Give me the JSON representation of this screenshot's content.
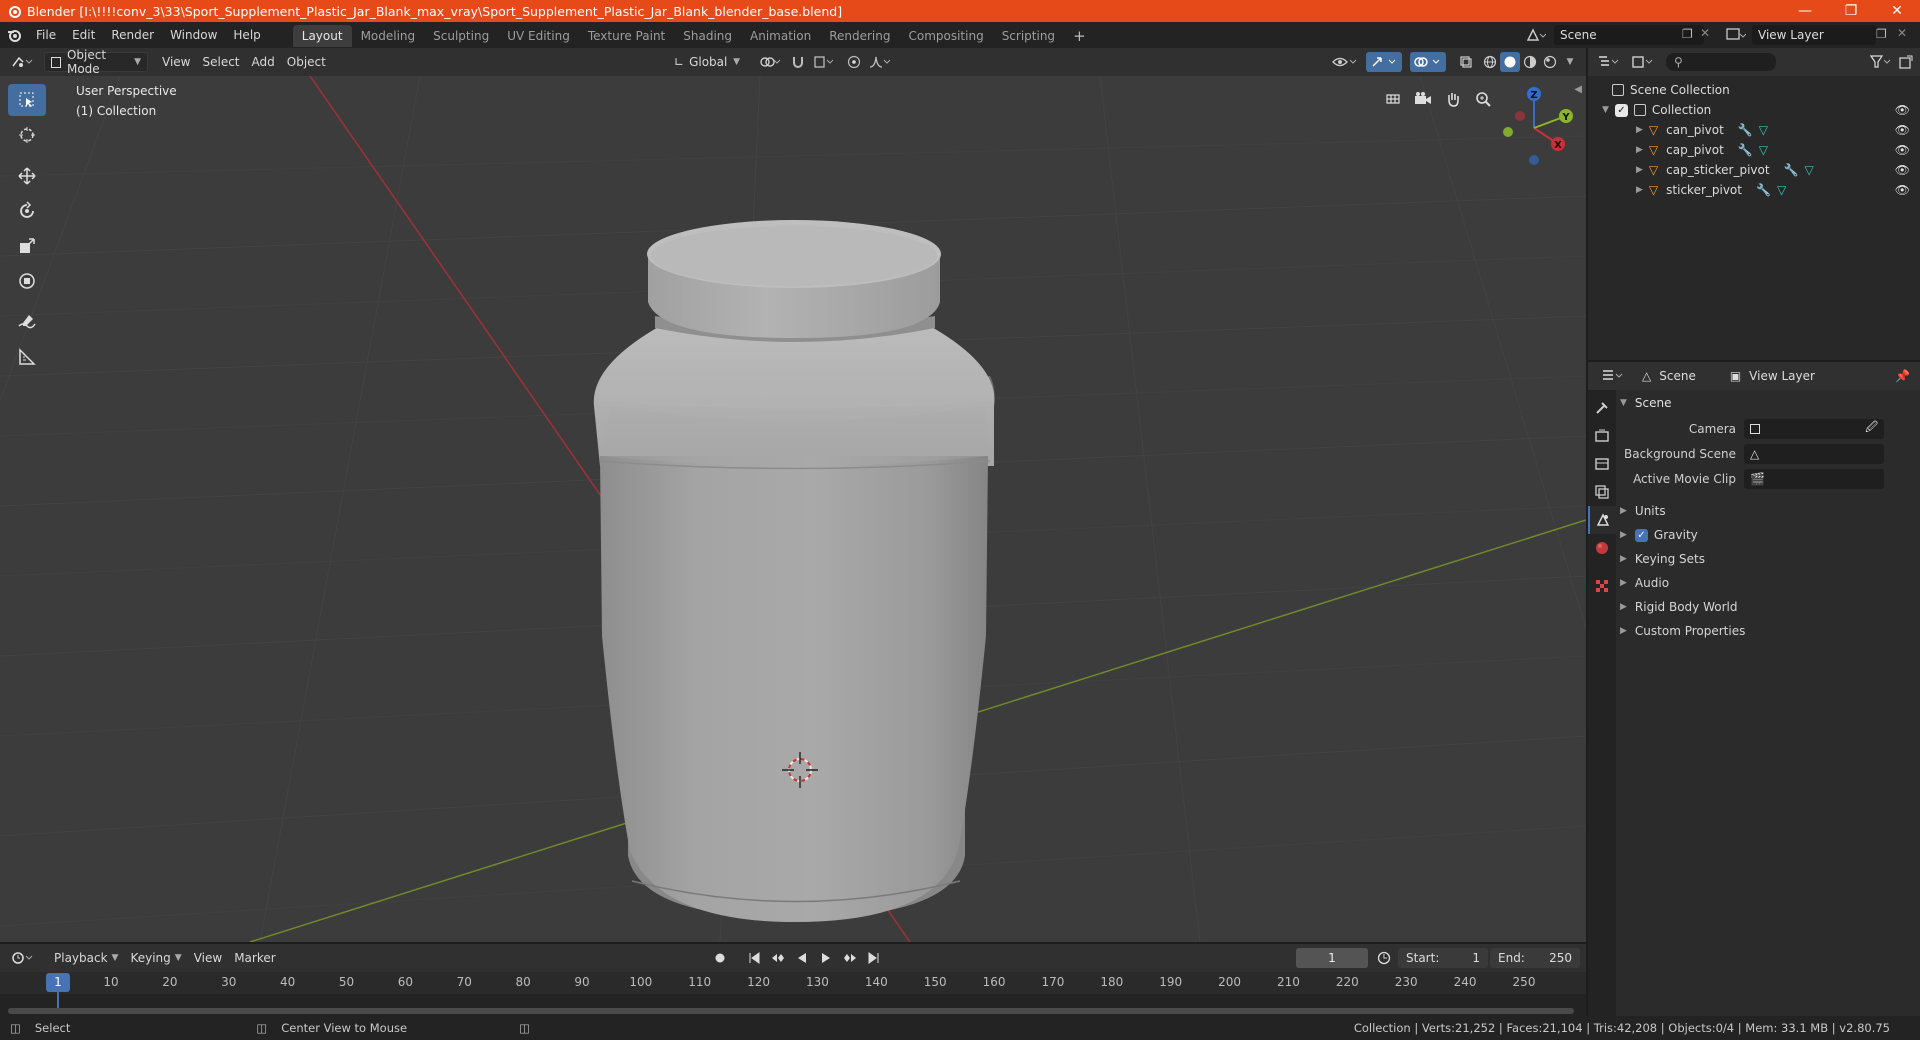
{
  "title": "Blender [I:\\!!!!conv_3\\33\\Sport_Supplement_Plastic_Jar_Blank_max_vray\\Sport_Supplement_Plastic_Jar_Blank_blender_base.blend]",
  "menu": [
    "File",
    "Edit",
    "Render",
    "Window",
    "Help"
  ],
  "workspaces": [
    "Layout",
    "Modeling",
    "Sculpting",
    "UV Editing",
    "Texture Paint",
    "Shading",
    "Animation",
    "Rendering",
    "Compositing",
    "Scripting"
  ],
  "active_workspace": "Layout",
  "scene_name": "Scene",
  "view_layer_name": "View Layer",
  "viewport": {
    "mode": "Object Mode",
    "menus": [
      "View",
      "Select",
      "Add",
      "Object"
    ],
    "transform": "Global",
    "perspective": "User Perspective",
    "collection": "(1) Collection"
  },
  "gizmo": {
    "x": "X",
    "y": "Y",
    "z": "Z"
  },
  "outliner": {
    "root": "Scene Collection",
    "collection": "Collection",
    "objects": [
      "can_pivot",
      "cap_pivot",
      "cap_sticker_pivot",
      "sticker_pivot"
    ]
  },
  "properties": {
    "header_scene": "Scene",
    "header_view_layer": "View Layer",
    "panel_title": "Scene",
    "camera_label": "Camera",
    "background_scene_label": "Background Scene",
    "active_movie_clip_label": "Active Movie Clip",
    "subpanels": [
      "Units",
      "Gravity",
      "Keying Sets",
      "Audio",
      "Rigid Body World",
      "Custom Properties"
    ]
  },
  "timeline": {
    "menus": [
      "Playback",
      "Keying",
      "View",
      "Marker"
    ],
    "current_frame": "1",
    "start_label": "Start:",
    "start": "1",
    "end_label": "End:",
    "end": "250",
    "ticks": [
      "1",
      "10",
      "20",
      "30",
      "40",
      "50",
      "60",
      "70",
      "80",
      "90",
      "100",
      "110",
      "120",
      "130",
      "140",
      "150",
      "160",
      "170",
      "180",
      "190",
      "200",
      "210",
      "220",
      "230",
      "240",
      "250"
    ]
  },
  "status": {
    "left": "Select",
    "middle": "Center View to Mouse",
    "right": "Collection | Verts:21,252 | Faces:21,104 | Tris:42,208 | Objects:0/4 | Mem: 33.1 MB | v2.80.75"
  },
  "colors": {
    "accent": "#4772b3",
    "titlebar": "#e64a19",
    "x_axis": "#c8303a",
    "y_axis": "#8ab62c",
    "z_axis": "#2f6fd0"
  }
}
